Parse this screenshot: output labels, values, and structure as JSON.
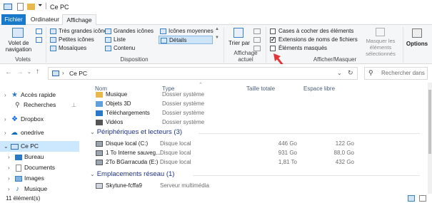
{
  "window": {
    "title": "Ce PC"
  },
  "ribbon": {
    "tabs": [
      "Fichier",
      "Ordinateur",
      "Affichage"
    ],
    "volets": {
      "nav_pane_label": "Volet de navigation",
      "group_label": "Volets"
    },
    "disposition": {
      "items": [
        "Très grandes icônes",
        "Grandes icônes",
        "Icônes moyennes",
        "Petites icônes",
        "Liste",
        "Détails",
        "Mosaïques",
        "Contenu"
      ],
      "selected": "Détails",
      "group_label": "Disposition"
    },
    "affichage_actuel": {
      "sort_label": "Trier par",
      "group_label": "Affichage actuel"
    },
    "afficher_masquer": {
      "checkboxes": [
        {
          "label": "Cases à cocher des éléments",
          "checked": false
        },
        {
          "label": "Extensions de noms de fichiers",
          "checked": true
        },
        {
          "label": "Éléments masqués",
          "checked": false
        }
      ],
      "hide_selected_label": "Masquer les éléments sélectionnés",
      "group_label": "Afficher/Masquer"
    },
    "options_label": "Options"
  },
  "address": {
    "path": "Ce PC",
    "search_placeholder": "Rechercher dans"
  },
  "nav_pane": {
    "items": [
      {
        "label": "Accès rapide",
        "indent": 1
      },
      {
        "label": "Recherches",
        "indent": 2
      },
      {
        "label": "Dropbox",
        "indent": 1
      },
      {
        "label": "onedrive",
        "indent": 1
      },
      {
        "label": "Ce PC",
        "indent": 1,
        "selected": true
      },
      {
        "label": "Bureau",
        "indent": 2
      },
      {
        "label": "Documents",
        "indent": 2
      },
      {
        "label": "Images",
        "indent": 2
      },
      {
        "label": "Musique",
        "indent": 2
      }
    ]
  },
  "columns": {
    "name": "Nom",
    "type": "Type",
    "total": "Taille totale",
    "free": "Espace libre"
  },
  "folders": [
    {
      "name": "Musique",
      "type": "Dossier système"
    },
    {
      "name": "Objets 3D",
      "type": "Dossier système"
    },
    {
      "name": "Téléchargements",
      "type": "Dossier système"
    },
    {
      "name": "Vidéos",
      "type": "Dossier système"
    }
  ],
  "groups": {
    "devices": "Périphériques et lecteurs (3)",
    "network": "Emplacements réseau (1)"
  },
  "drives": [
    {
      "name": "Disque local (C:)",
      "type": "Disque local",
      "total": "446 Go",
      "free": "122 Go"
    },
    {
      "name": "1 To Interne sauveg...",
      "type": "Disque local",
      "total": "931 Go",
      "free": "88,0 Go"
    },
    {
      "name": "2To BGarracuda (E:)",
      "type": "Disque local",
      "total": "1,81 To",
      "free": "432 Go"
    }
  ],
  "network": [
    {
      "name": "Skytune-fcffa9",
      "type": "Serveur multimédia"
    }
  ],
  "status": {
    "count": "11 élément(s)"
  },
  "colors": {
    "accent": "#1979ca",
    "selection": "#cce8ff",
    "annotation_arrow": "#e0353a"
  }
}
